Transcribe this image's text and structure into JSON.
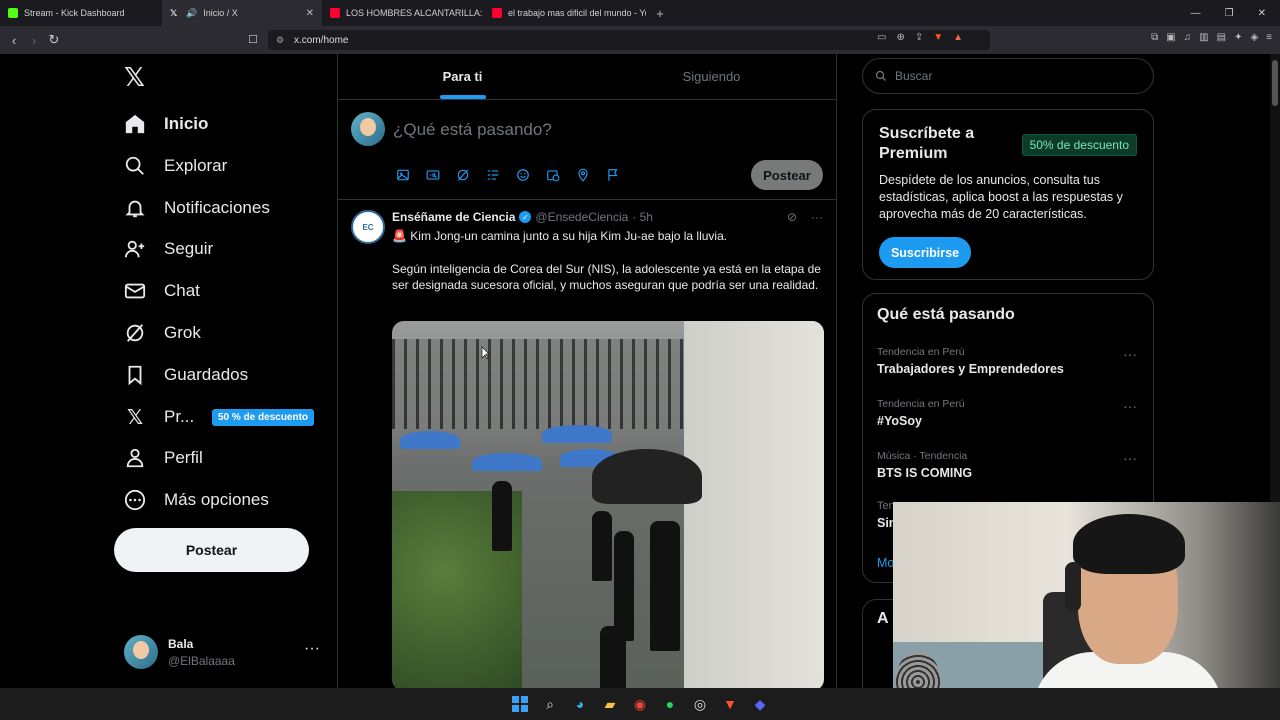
{
  "browser": {
    "tabs": [
      {
        "title": "Stream - Kick Dashboard",
        "color": "#53fc18"
      },
      {
        "title": "Inicio / X",
        "color": "#ffffff"
      },
      {
        "title": "LOS HOMBRES ALCANTARILLA: el tra",
        "color": "#ff0033"
      },
      {
        "title": "el trabajo mas dificil del mundo - You",
        "color": "#ff0033"
      }
    ],
    "url": "x.com/home"
  },
  "nav": {
    "items": [
      {
        "label": "Inicio",
        "icon": "home-icon"
      },
      {
        "label": "Explorar",
        "icon": "search-icon"
      },
      {
        "label": "Notificaciones",
        "icon": "bell-icon"
      },
      {
        "label": "Seguir",
        "icon": "follow-icon"
      },
      {
        "label": "Chat",
        "icon": "mail-icon"
      },
      {
        "label": "Grok",
        "icon": "grok-icon"
      },
      {
        "label": "Guardados",
        "icon": "bookmark-icon"
      },
      {
        "label": "Pr...",
        "icon": "x-premium-icon"
      },
      {
        "label": "Perfil",
        "icon": "profile-icon"
      },
      {
        "label": "Más opciones",
        "icon": "more-icon"
      }
    ],
    "premium_badge": "50 % de descuento",
    "post_button": "Postear",
    "account": {
      "name": "Bala",
      "handle": "@ElBalaaaa"
    }
  },
  "timeline": {
    "tabs": [
      "Para ti",
      "Siguiendo"
    ],
    "compose_placeholder": "¿Qué está pasando?",
    "compose_button": "Postear",
    "tweet": {
      "name": "Enséñame de Ciencia",
      "handle": "@EnsedeCiencia",
      "time": "· 5h",
      "avatar_text": "EC",
      "line1": "🚨 Kim Jong-un camina junto a su hija Kim Ju-ae bajo la lluvia.",
      "line2": "Según inteligencia de Corea del Sur (NIS), la adolescente ya está en la etapa de ser designada sucesora oficial, y muchos aseguran que podría ser una realidad."
    }
  },
  "sidebar": {
    "search_placeholder": "Buscar",
    "premium": {
      "title": "Suscríbete a Premium",
      "badge": "50% de descuento",
      "desc": "Despídete de los anuncios, consulta tus estadísticas, aplica boost a las respuestas y aprovecha más de 20 características.",
      "button": "Suscribirse"
    },
    "trends_title": "Qué está pasando",
    "trends": [
      {
        "meta": "Tendencia en Perú",
        "name": "Trabajadores y Emprendedores"
      },
      {
        "meta": "Tendencia en Perú",
        "name": "#YoSoy"
      },
      {
        "meta": "Música · Tendencia",
        "name": "BTS IS COMING"
      }
    ],
    "trend_partial_1": "Ten",
    "trend_partial_2": "Sin",
    "show_more": "Mo",
    "next_card_title": "A"
  }
}
